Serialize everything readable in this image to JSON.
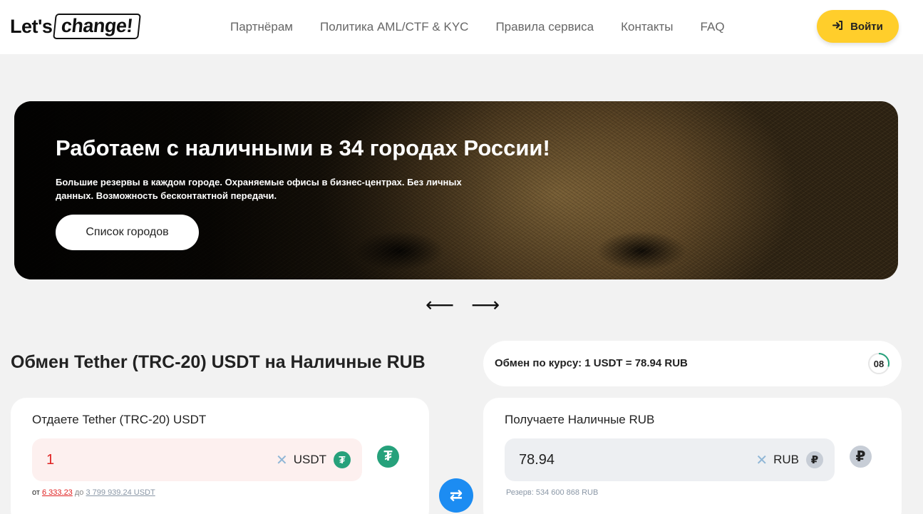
{
  "header": {
    "logo_lets": "Let's",
    "logo_change": "change!",
    "nav": [
      "Партнёрам",
      "Политика AML/CTF & KYC",
      "Правила сервиса",
      "Контакты",
      "FAQ"
    ],
    "login_label": "Войти",
    "login_icon": "login-arrow-icon"
  },
  "hero": {
    "title": "Работаем с наличными в 34 городах России!",
    "subtitle": "Большие резервы в каждом городе. Охраняемые офисы в бизнес-центрах. Без личных данных. Возможность бесконтактной передачи.",
    "button_label": "Список городов",
    "arrow_prev": "⟵",
    "arrow_next": "⟶"
  },
  "exchange": {
    "title": "Обмен Tether (TRC-20) USDT на Наличные RUB",
    "rate_text": "Обмен по курсу: 1 USDT = 78.94 RUB",
    "timer": "08",
    "timer_progress": 0.3,
    "give": {
      "title": "Отдаете Tether (TRC-20) USDT",
      "value": "1",
      "currency": "USDT",
      "min_prefix": "от",
      "min_value": "6 333.23",
      "max_prefix": "до",
      "max_value": "3 799 939.24 USDT"
    },
    "get": {
      "title": "Получаете Наличные RUB",
      "value": "78.94",
      "currency": "RUB",
      "reserve": "Резерв: 534 600 868 RUB"
    },
    "clear_symbol": "✕",
    "swap_symbol": "⇄"
  },
  "colors": {
    "accent_yellow": "#ffce2b",
    "swap_blue": "#1c8cf2",
    "tether_green": "#26a17b",
    "error_red": "#e02222"
  }
}
